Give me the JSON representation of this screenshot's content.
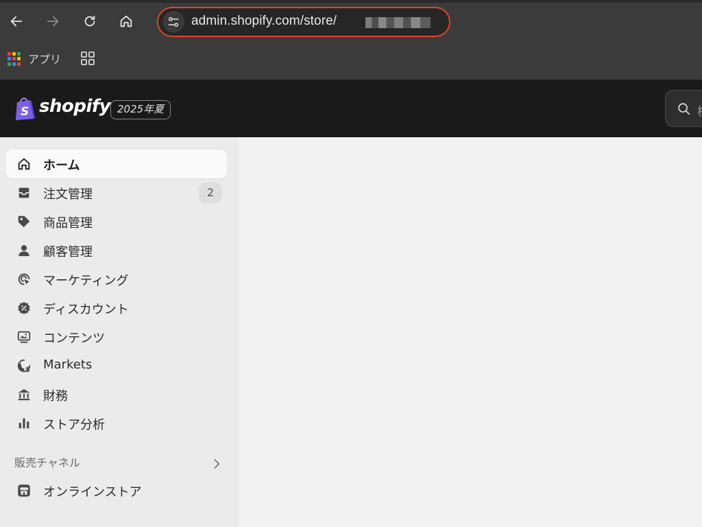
{
  "browser": {
    "url": "admin.shopify.com/store/",
    "bookmarks": {
      "apps_label": "アプリ"
    },
    "colors": {
      "address_highlight": "#e0452a"
    }
  },
  "header": {
    "brand": "shopify",
    "edition": "2025年夏",
    "search_peek": "検"
  },
  "sidebar": {
    "items": [
      {
        "label": "ホーム",
        "icon": "home-icon",
        "active": true
      },
      {
        "label": "注文管理",
        "icon": "inbox-icon",
        "badge": "2"
      },
      {
        "label": "商品管理",
        "icon": "tag-icon"
      },
      {
        "label": "顧客管理",
        "icon": "person-icon"
      },
      {
        "label": "マーケティング",
        "icon": "target-icon"
      },
      {
        "label": "ディスカウント",
        "icon": "discount-icon"
      },
      {
        "label": "コンテンツ",
        "icon": "content-icon"
      },
      {
        "label": "Markets",
        "icon": "globe-icon"
      },
      {
        "label": "財務",
        "icon": "bank-icon"
      },
      {
        "label": "ストア分析",
        "icon": "bar-chart-icon"
      }
    ],
    "sales_channels": {
      "title": "販売チャネル",
      "items": [
        {
          "label": "オンラインストア",
          "icon": "store-icon"
        }
      ]
    }
  }
}
